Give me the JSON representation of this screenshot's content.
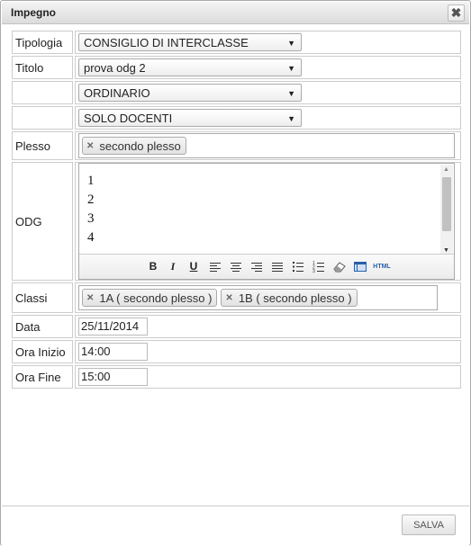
{
  "dialog": {
    "title": "Impegno",
    "close_glyph": "✖"
  },
  "form": {
    "tipologia": {
      "label": "Tipologia",
      "value": "CONSIGLIO DI INTERCLASSE"
    },
    "titolo": {
      "label": "Titolo",
      "value": "prova odg 2"
    },
    "tipo_seduta": {
      "value": "ORDINARIO"
    },
    "partecipanti": {
      "value": "SOLO DOCENTI"
    },
    "plesso": {
      "label": "Plesso",
      "tags": [
        "secondo plesso"
      ]
    },
    "odg": {
      "label": "ODG",
      "lines": [
        "1",
        "2",
        "3",
        "4"
      ],
      "toolbar": {
        "bold": "B",
        "italic": "I",
        "underline": "U",
        "html": "HTML"
      }
    },
    "classi": {
      "label": "Classi",
      "tags": [
        "1A ( secondo plesso )",
        "1B ( secondo plesso )"
      ]
    },
    "data": {
      "label": "Data",
      "value": "25/11/2014"
    },
    "ora_inizio": {
      "label": "Ora Inizio",
      "value": "14:00"
    },
    "ora_fine": {
      "label": "Ora Fine",
      "value": "15:00"
    }
  },
  "footer": {
    "save_label": "SALVA"
  },
  "icons": {
    "dropdown": "chevron-down-icon",
    "remove_tag": "close-icon"
  }
}
